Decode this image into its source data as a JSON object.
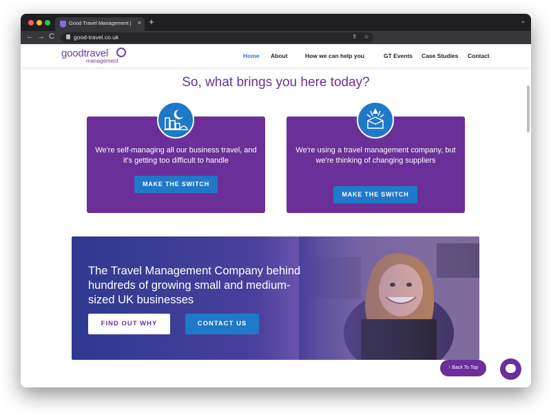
{
  "browser": {
    "tab_title": "Good Travel Management | Bu",
    "tab_close": "×",
    "new_tab": "+",
    "tab_menu": "⌄",
    "back": "←",
    "forward": "→",
    "reload": "C",
    "url": "good-travel.co.uk",
    "share_icon": "⇪",
    "bookmark_icon": "☆"
  },
  "header": {
    "logo_main": "goodtravel",
    "logo_sub": "management",
    "nav": [
      "Home",
      "About",
      "How we can help you",
      "GT Events",
      "Case Studies",
      "Contact"
    ],
    "active_nav": "Home"
  },
  "main": {
    "heading": "So, what brings you here today?",
    "cards": [
      {
        "text": "We're self-managing all our business travel, and it's getting too difficult to handle",
        "button": "MAKE THE SWITCH",
        "icon": "city-night-icon"
      },
      {
        "text": "We're using a travel management company, but we're thinking of changing suppliers",
        "button": "MAKE THE SWITCH",
        "icon": "suitcase-icon"
      }
    ],
    "hero": {
      "text": "The Travel Management Company behind hundreds of growing small and medium-sized UK businesses",
      "primary_button": "FIND OUT WHY",
      "secondary_button": "CONTACT US"
    }
  },
  "widgets": {
    "back_to_top": "↑ Back To Top",
    "chat_icon": "chat-icon"
  },
  "colors": {
    "brand_purple": "#6a2f98",
    "brand_blue": "#1f79c8",
    "active_nav": "#2c7ad6"
  }
}
